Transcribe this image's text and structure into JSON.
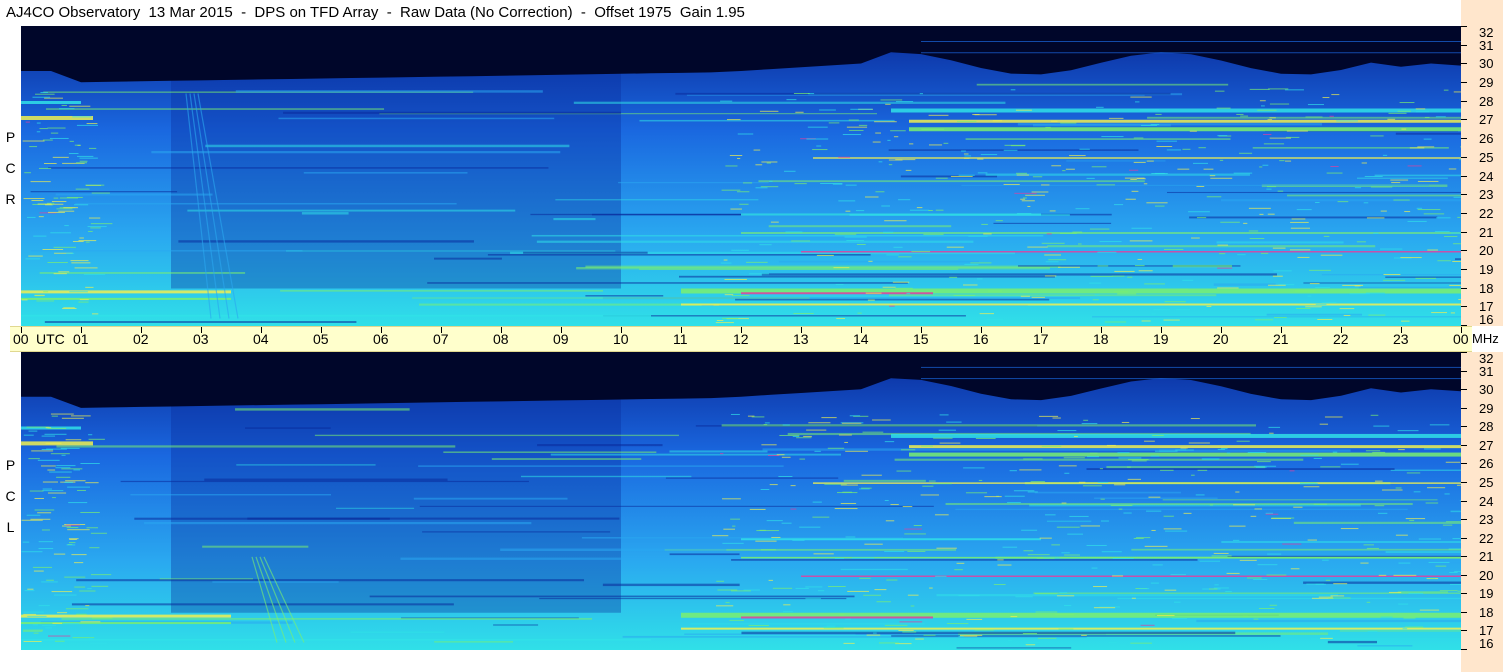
{
  "title": "AJ4CO Observatory  13 Mar 2015  -  DPS on TFD Array  -  Raw Data (No Correction)  -  Offset 1975  Gain 1.95",
  "rcp_label": [
    "R",
    "C",
    "P"
  ],
  "lcp_label": [
    "L",
    "C",
    "P"
  ],
  "time_axis": {
    "labels": [
      "00",
      "01",
      "02",
      "03",
      "04",
      "05",
      "06",
      "07",
      "08",
      "09",
      "10",
      "11",
      "12",
      "13",
      "14",
      "15",
      "16",
      "17",
      "18",
      "19",
      "20",
      "21",
      "22",
      "23",
      "00"
    ],
    "utc_label": "UTC",
    "unit_label": "MHz"
  },
  "colors": {
    "night": "#00062a",
    "band_dark": "#0a2a9a",
    "band_mid": "#1a68e0",
    "band_bright": "#2aa8f0",
    "cyan": "#30e0e8",
    "green": "#7af070",
    "yellow": "#f0f050",
    "magenta": "#e040a0",
    "axis_bg": "#ffffcc",
    "freq_bg": "#ffe6cc"
  },
  "chart_data": [
    {
      "type": "heatmap",
      "name": "RCP",
      "x_unit": "UTC hours",
      "y_unit": "MHz",
      "xlim": [
        0,
        24
      ],
      "ylim": [
        16,
        32
      ],
      "y_ticks": [
        32,
        31,
        30,
        29,
        28,
        27,
        26,
        25,
        24,
        23,
        22,
        21,
        20,
        19,
        18,
        17,
        16
      ]
    },
    {
      "type": "heatmap",
      "name": "LCP",
      "x_unit": "UTC hours",
      "y_unit": "MHz",
      "xlim": [
        0,
        24
      ],
      "ylim": [
        16,
        32
      ],
      "y_ticks": [
        32,
        31,
        30,
        29,
        28,
        27,
        26,
        25,
        24,
        23,
        22,
        21,
        20,
        19,
        18,
        17,
        16
      ]
    }
  ]
}
